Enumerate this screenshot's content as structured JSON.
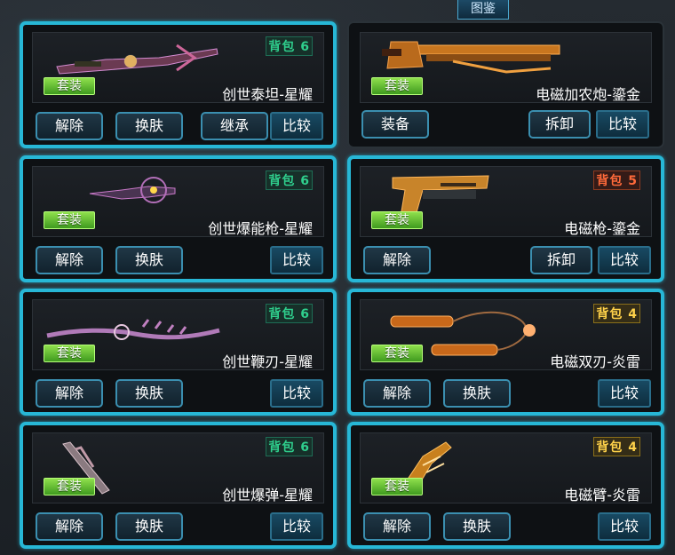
{
  "header": {
    "tab_label": "图鉴"
  },
  "cards": [
    {
      "bag": "背包 6",
      "bag_color": "#2fcf8d",
      "set": "套装",
      "name": "创世泰坦-星耀",
      "icon": "crossbow-icon",
      "buttons": [
        "解除",
        "换肤",
        "继承"
      ],
      "compare": "比较",
      "selected": true
    },
    {
      "bag": "",
      "set": "套装",
      "name": "电磁加农炮-鎏金",
      "icon": "railgun-icon",
      "buttons": [
        "装备",
        "拆卸"
      ],
      "compare": "比较",
      "selected": false
    },
    {
      "bag": "背包 6",
      "bag_color": "#2fcf8d",
      "set": "套装",
      "name": "创世爆能枪-星耀",
      "icon": "blaster-icon",
      "buttons": [
        "解除",
        "换肤"
      ],
      "compare": "比较",
      "selected": true
    },
    {
      "bag": "背包 5",
      "bag_color": "#ff6a3a",
      "set": "套装",
      "name": "电磁枪-鎏金",
      "icon": "pistol-icon",
      "buttons": [
        "解除",
        "拆卸"
      ],
      "compare": "比较",
      "selected": true
    },
    {
      "bag": "背包 6",
      "bag_color": "#2fcf8d",
      "set": "套装",
      "name": "创世鞭刃-星耀",
      "icon": "whip-blade-icon",
      "buttons": [
        "解除",
        "换肤"
      ],
      "compare": "比较",
      "selected": true
    },
    {
      "bag": "背包 4",
      "bag_color": "#ffd24a",
      "set": "套装",
      "name": "电磁双刃-炎雷",
      "icon": "nunchaku-icon",
      "buttons": [
        "解除",
        "换肤"
      ],
      "compare": "比较",
      "selected": true
    },
    {
      "bag": "背包 6",
      "bag_color": "#2fcf8d",
      "set": "套装",
      "name": "创世爆弹-星耀",
      "icon": "grenade-launcher-icon",
      "buttons": [
        "解除",
        "换肤"
      ],
      "compare": "比较",
      "selected": true
    },
    {
      "bag": "背包 4",
      "bag_color": "#ffd24a",
      "set": "套装",
      "name": "电磁臂-炎雷",
      "icon": "gauntlet-icon",
      "buttons": [
        "解除",
        "换肤"
      ],
      "compare": "比较",
      "selected": true
    }
  ]
}
